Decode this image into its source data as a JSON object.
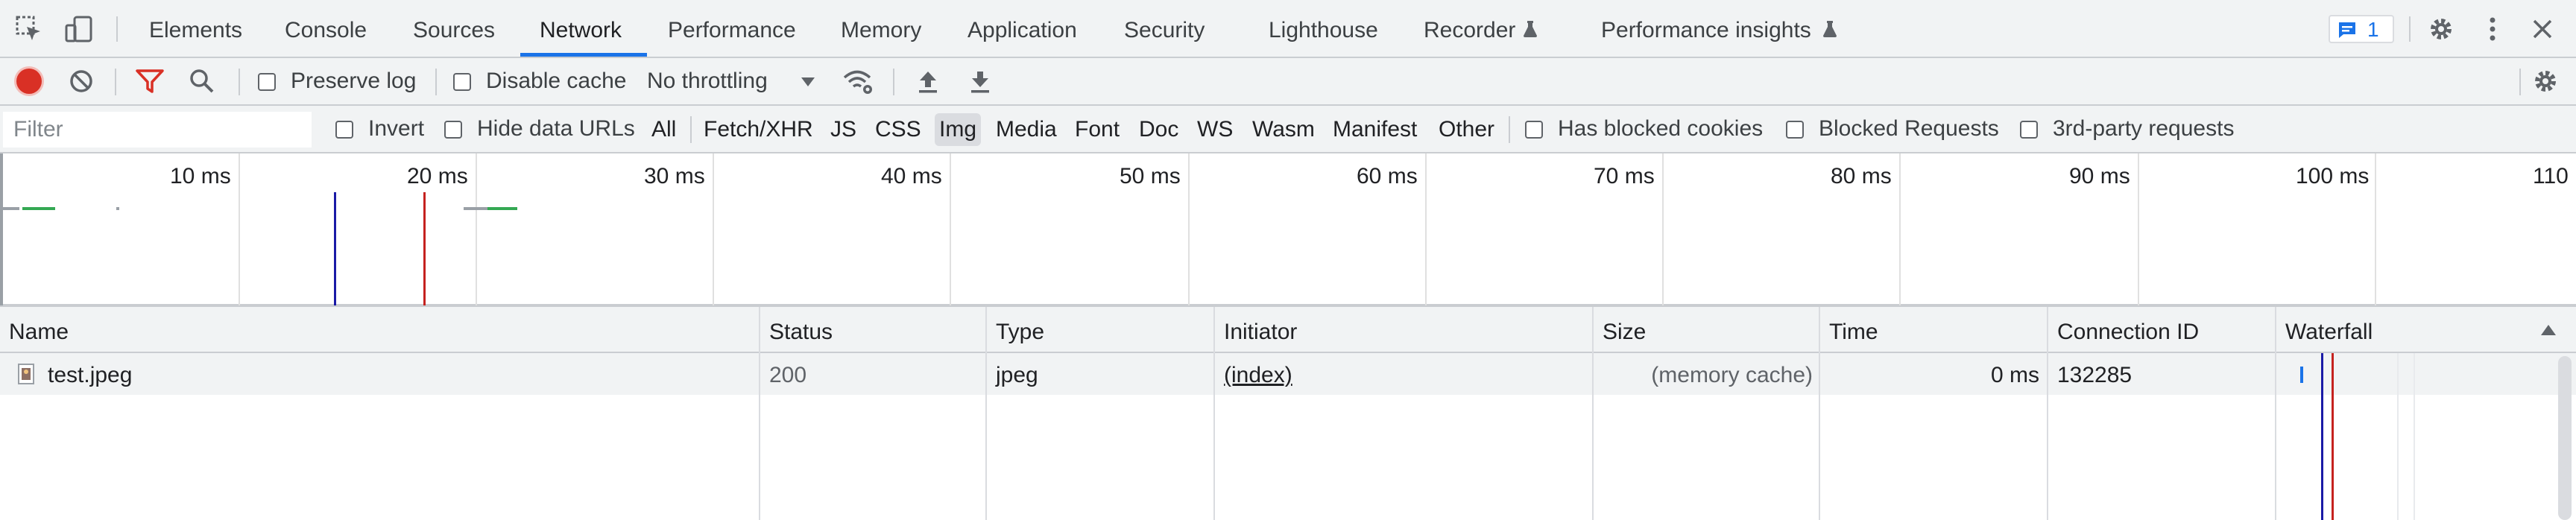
{
  "tabs": {
    "items": [
      "Elements",
      "Console",
      "Sources",
      "Network",
      "Performance",
      "Memory",
      "Application",
      "Security",
      "Lighthouse",
      "Recorder",
      "Performance insights"
    ],
    "selected": "Network",
    "issues_count": "1"
  },
  "toolbar": {
    "preserve_log": "Preserve log",
    "disable_cache": "Disable cache",
    "throttling": "No throttling"
  },
  "filter": {
    "placeholder": "Filter",
    "invert": "Invert",
    "hide_data_urls": "Hide data URLs",
    "types": [
      "All",
      "Fetch/XHR",
      "JS",
      "CSS",
      "Img",
      "Media",
      "Font",
      "Doc",
      "WS",
      "Wasm",
      "Manifest",
      "Other"
    ],
    "selected_type": "Img",
    "has_blocked_cookies": "Has blocked cookies",
    "blocked_requests": "Blocked Requests",
    "third_party": "3rd-party requests"
  },
  "overview": {
    "ticks": [
      "10 ms",
      "20 ms",
      "30 ms",
      "40 ms",
      "50 ms",
      "60 ms",
      "70 ms",
      "80 ms",
      "90 ms",
      "100 ms",
      "110"
    ]
  },
  "table": {
    "headers": {
      "name": "Name",
      "status": "Status",
      "type": "Type",
      "initiator": "Initiator",
      "size": "Size",
      "time": "Time",
      "connection_id": "Connection ID",
      "waterfall": "Waterfall"
    },
    "rows": [
      {
        "name": "test.jpeg",
        "status": "200",
        "type": "jpeg",
        "initiator": "(index)",
        "size": "(memory cache)",
        "time": "0 ms",
        "connection_id": "132285"
      }
    ]
  },
  "colors": {
    "accent": "#1a73e8",
    "record": "#d93025",
    "filter_icon": "#d93025"
  }
}
